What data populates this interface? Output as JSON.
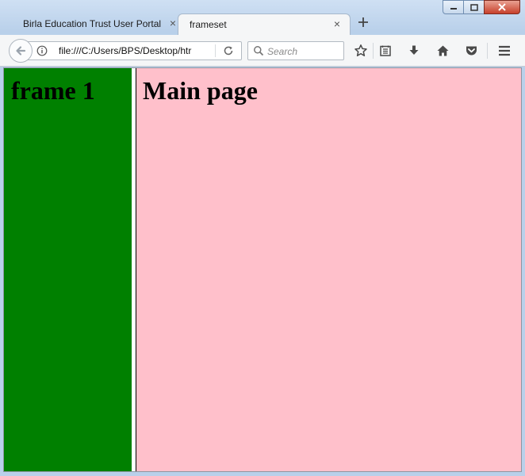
{
  "browser": {
    "tabs": [
      {
        "label": "Birla Education Trust User Portal",
        "active": false
      },
      {
        "label": "frameset",
        "active": true
      }
    ],
    "new_tab_icon": "plus-icon",
    "url": "file:///C:/Users/BPS/Desktop/htr",
    "search_placeholder": "Search",
    "toolbar_icons": [
      "bookmark-star-icon",
      "reading-list-icon",
      "download-icon",
      "home-icon",
      "pocket-icon",
      "menu-icon"
    ],
    "window_controls": [
      "minimize-icon",
      "maximize-icon",
      "close-icon"
    ]
  },
  "page": {
    "left_frame": {
      "heading": "frame 1",
      "background": "#008000"
    },
    "main_frame": {
      "heading": "Main page",
      "background": "#ffc0cb"
    }
  }
}
